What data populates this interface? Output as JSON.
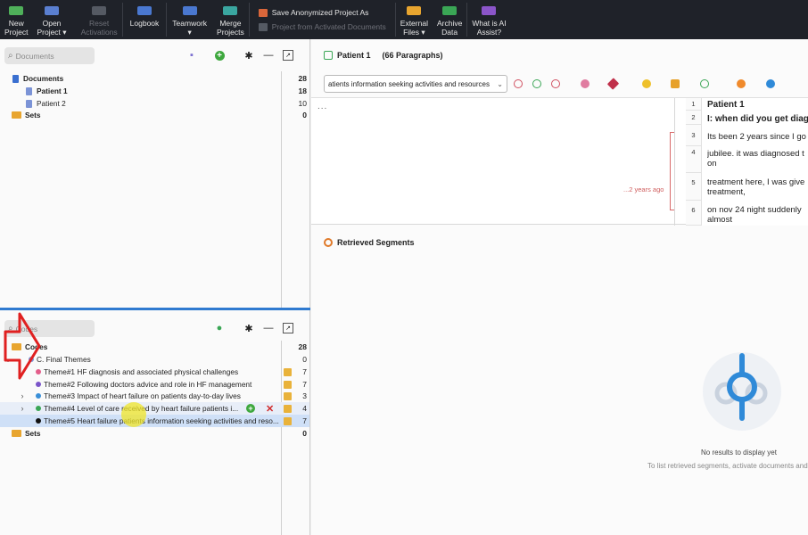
{
  "ribbon": {
    "new_project": "New\nProject",
    "open_project": "Open\nProject ▾",
    "reset_activations": "Reset\nActivations",
    "logbook": "Logbook",
    "teamwork": "Teamwork\n▾",
    "merge_projects": "Merge\nProjects",
    "save_anonymized": "Save Anonymized Project As",
    "project_from_activated": "Project from Activated Documents",
    "external_files": "External\nFiles ▾",
    "archive_data": "Archive\nData",
    "ai_assist": "What is AI\nAssist?"
  },
  "documents_pane": {
    "search_placeholder": "Documents",
    "items": [
      {
        "label": "Documents",
        "count": "28"
      },
      {
        "label": "Patient 1",
        "count": "18"
      },
      {
        "label": "Patient 2",
        "count": "10"
      },
      {
        "label": "Sets",
        "count": "0"
      }
    ]
  },
  "codes_pane": {
    "search_placeholder": "Codes",
    "root": {
      "label": "Codes",
      "count": "28"
    },
    "group": {
      "label": "C. Final Themes",
      "count": "0"
    },
    "themes": [
      {
        "label": "Theme#1 HF diagnosis and associated physical challenges",
        "count": "7",
        "dot": "#e35d8a"
      },
      {
        "label": "Theme#2 Following doctors advice and role in HF management",
        "count": "7",
        "dot": "#7b55c9"
      },
      {
        "label": "Theme#3 Impact of heart failure on patients day-to-day lives",
        "count": "3",
        "dot": "#3a8fd8"
      },
      {
        "label": "Theme#4 Level of care received by heart failure patients i...",
        "count": "4",
        "dot": "#3aa655"
      },
      {
        "label": "Theme#5 Heart failure patients information seeking activities and reso...",
        "count": "7",
        "dot": "#111111"
      }
    ],
    "sets": {
      "label": "Sets",
      "count": "0"
    }
  },
  "document_browser": {
    "title": "Patient 1",
    "paragraphs_label": "(66 Paragraphs)",
    "code_selector_value": "atients information seeking activities and resources",
    "more": "...",
    "time_label": "...2 years ago",
    "paragraphs": [
      {
        "num": "1",
        "text": "Patient 1"
      },
      {
        "num": "2",
        "text": "I: when did you get diag"
      },
      {
        "num": "3",
        "text": "Its been 2 years since I go"
      },
      {
        "num": "4",
        "text": "jubilee. it was diagnosed t on"
      },
      {
        "num": "5",
        "text": "treatment here, I was give treatment,"
      },
      {
        "num": "6",
        "text": "on nov 24 night suddenly almost"
      }
    ]
  },
  "retrieved_segments": {
    "title": "Retrieved Segments",
    "empty_title": "No results to display yet",
    "empty_hint": "To list retrieved segments, activate documents and"
  },
  "colors": {
    "ribbon_bg": "#1f2229",
    "accent_blue": "#2f7ad0",
    "annotation_red": "#e02020",
    "highlight_yellow": "#f0e628"
  }
}
